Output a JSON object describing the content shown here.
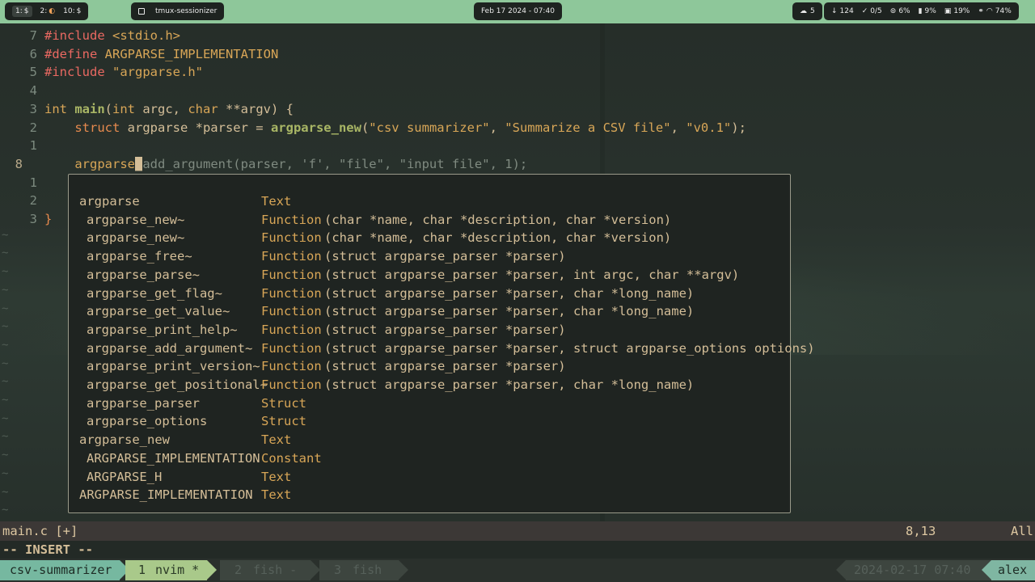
{
  "topbar": {
    "workspaces": [
      {
        "num": "1:",
        "icon": "$",
        "active": true
      },
      {
        "num": "2:",
        "icon": "◐",
        "active": false
      },
      {
        "num": "10:",
        "icon": "$",
        "active": false
      }
    ],
    "window_title": "tmux-sessionizer",
    "clock": "Feb 17 2024 - 07:40",
    "weather": "5",
    "stats": {
      "download": "124",
      "updates": "0/5",
      "cpu": "6%",
      "memory": "9%",
      "disk": "19%",
      "battery": "74%"
    }
  },
  "editor": {
    "lines": [
      {
        "num": "7",
        "tokens": [
          {
            "t": "#include ",
            "c": "inc"
          },
          {
            "t": "<stdio.h>",
            "c": "str"
          }
        ]
      },
      {
        "num": "6",
        "tokens": [
          {
            "t": "#define ",
            "c": "inc"
          },
          {
            "t": "ARGPARSE_IMPLEMENTATION",
            "c": "str"
          }
        ]
      },
      {
        "num": "5",
        "tokens": [
          {
            "t": "#include ",
            "c": "inc"
          },
          {
            "t": "\"argparse.h\"",
            "c": "str"
          }
        ]
      },
      {
        "num": "4",
        "tokens": []
      },
      {
        "num": "3",
        "tokens": [
          {
            "t": "int ",
            "c": "str"
          },
          {
            "t": "main",
            "c": "fn"
          },
          {
            "t": "(",
            "c": "plain"
          },
          {
            "t": "int ",
            "c": "str"
          },
          {
            "t": "argc, ",
            "c": "plain"
          },
          {
            "t": "char ",
            "c": "str"
          },
          {
            "t": "**argv) {",
            "c": "plain"
          }
        ]
      },
      {
        "num": "2",
        "tokens": [
          {
            "t": "    ",
            "c": "plain"
          },
          {
            "t": "struct ",
            "c": "type"
          },
          {
            "t": "argparse *parser = ",
            "c": "plain"
          },
          {
            "t": "argparse_new",
            "c": "fn"
          },
          {
            "t": "(",
            "c": "plain"
          },
          {
            "t": "\"csv summarizer\"",
            "c": "str"
          },
          {
            "t": ", ",
            "c": "plain"
          },
          {
            "t": "\"Summarize a CSV file\"",
            "c": "str"
          },
          {
            "t": ", ",
            "c": "plain"
          },
          {
            "t": "\"v0.1\"",
            "c": "str"
          },
          {
            "t": ");",
            "c": "plain"
          }
        ]
      },
      {
        "num": "1",
        "tokens": []
      },
      {
        "num": "8",
        "current": true,
        "tokens": [
          {
            "t": "    ",
            "c": "plain"
          },
          {
            "t": "argparse",
            "c": "str"
          },
          {
            "t": "_",
            "c": "cursor"
          },
          {
            "t": "add_argument(parser, 'f', \"file\", \"input file\", 1);",
            "c": "ghost"
          }
        ]
      },
      {
        "num": "1",
        "tokens": []
      },
      {
        "num": "2",
        "tokens": []
      },
      {
        "num": "3",
        "tokens": [
          {
            "t": "}",
            "c": "ret"
          }
        ]
      }
    ],
    "tilde": "~"
  },
  "completion": {
    "items": [
      {
        "abbr": "argparse",
        "kind": "Text",
        "menu": "",
        "indent": false
      },
      {
        "abbr": "argparse_new~",
        "kind": "Function",
        "menu": "(char *name, char *description, char *version)",
        "indent": true
      },
      {
        "abbr": "argparse_new~",
        "kind": "Function",
        "menu": "(char *name, char *description, char *version)",
        "indent": true
      },
      {
        "abbr": "argparse_free~",
        "kind": "Function",
        "menu": "(struct argparse_parser *parser)",
        "indent": true
      },
      {
        "abbr": "argparse_parse~",
        "kind": "Function",
        "menu": "(struct argparse_parser *parser, int argc, char **argv)",
        "indent": true
      },
      {
        "abbr": "argparse_get_flag~",
        "kind": "Function",
        "menu": "(struct argparse_parser *parser, char *long_name)",
        "indent": true
      },
      {
        "abbr": "argparse_get_value~",
        "kind": "Function",
        "menu": "(struct argparse_parser *parser, char *long_name)",
        "indent": true
      },
      {
        "abbr": "argparse_print_help~",
        "kind": "Function",
        "menu": "(struct argparse_parser *parser)",
        "indent": true
      },
      {
        "abbr": "argparse_add_argument~",
        "kind": "Function",
        "menu": "(struct argparse_parser *parser, struct argparse_options options)",
        "indent": true
      },
      {
        "abbr": "argparse_print_version~",
        "kind": "Function",
        "menu": "(struct argparse_parser *parser)",
        "indent": true
      },
      {
        "abbr": "argparse_get_positional~",
        "kind": "Function",
        "menu": "(struct argparse_parser *parser, char *long_name)",
        "indent": true
      },
      {
        "abbr": "argparse_parser",
        "kind": "Struct",
        "menu": "",
        "indent": true
      },
      {
        "abbr": "argparse_options",
        "kind": "Struct",
        "menu": "",
        "indent": true
      },
      {
        "abbr": "argparse_new",
        "kind": "Text",
        "menu": "",
        "indent": false
      },
      {
        "abbr": "ARGPARSE_IMPLEMENTATION",
        "kind": "Constant",
        "menu": "",
        "indent": true
      },
      {
        "abbr": "ARGPARSE_H",
        "kind": "Text",
        "menu": "",
        "indent": true
      },
      {
        "abbr": "ARGPARSE_IMPLEMENTATION",
        "kind": "Text",
        "menu": "",
        "indent": false
      }
    ]
  },
  "statusline": {
    "filename": "main.c [+]",
    "position": "8,13",
    "percent": "All"
  },
  "mode": "-- INSERT --",
  "tmux": {
    "session": "csv-summarizer",
    "windows": [
      {
        "num": "1",
        "name": "nvim *"
      },
      {
        "num": "2",
        "name": "fish -"
      },
      {
        "num": "3",
        "name": "fish"
      }
    ],
    "datetime": "2024-02-17  07:40",
    "host": "alex"
  }
}
